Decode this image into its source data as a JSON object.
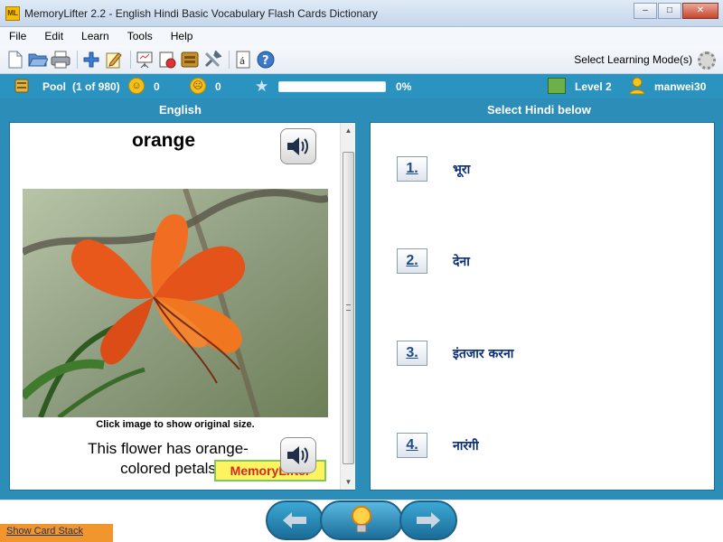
{
  "window": {
    "title": "MemoryLifter 2.2 - English Hindi Basic Vocabulary Flash Cards Dictionary",
    "app_icon_text": "ML",
    "min_symbol": "–",
    "max_symbol": "□",
    "close_symbol": "✕"
  },
  "menu": {
    "items": [
      "File",
      "Edit",
      "Learn",
      "Tools",
      "Help"
    ]
  },
  "toolbar": {
    "icons": [
      "new-icon",
      "open-icon",
      "print-icon",
      "add-icon",
      "edit-icon",
      "presentation-icon",
      "statistics-icon",
      "card-box-icon",
      "settings-icon",
      "character-icon",
      "help-icon"
    ],
    "learning_mode_label": "Select Learning Mode(s)"
  },
  "status": {
    "pool_label": "Pool",
    "pool_count": "(1 of 980)",
    "correct_count": "0",
    "wrong_count": "0",
    "progress_percent_label": "0%",
    "progress_fraction": 0,
    "level_label": "Level 2",
    "username": "manwei30"
  },
  "question": {
    "header": "English",
    "word": "orange",
    "image_caption": "Click image to show original size.",
    "example_sentence": "This flower has orange-colored petals",
    "brand_badge": "MemoryLifter"
  },
  "answers": {
    "header": "Select Hindi below",
    "choices": [
      {
        "number": "1.",
        "text": "भूरा"
      },
      {
        "number": "2.",
        "text": "देना"
      },
      {
        "number": "3.",
        "text": "इंतजार करना"
      },
      {
        "number": "4.",
        "text": "नारंगी"
      }
    ]
  },
  "nav": {
    "show_card_stack": "Show Card Stack"
  },
  "colors": {
    "panel_blue": "#2b8db8",
    "accent_orange": "#f0962c",
    "progress_green": "#7fd26b"
  }
}
